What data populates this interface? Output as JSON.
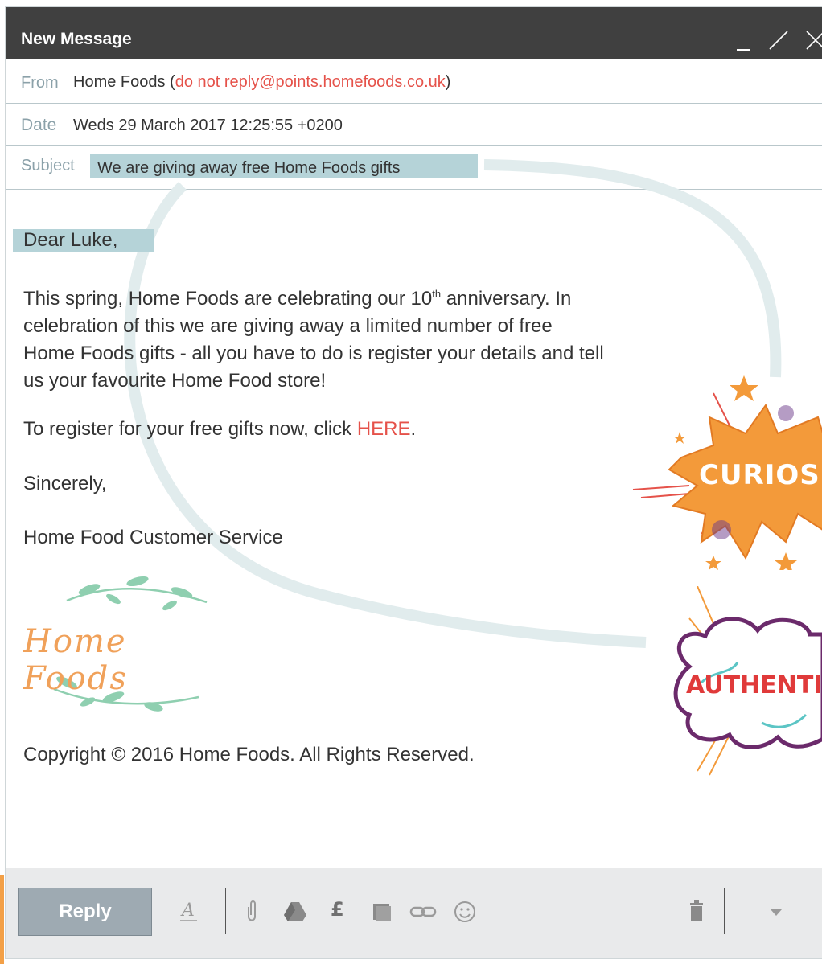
{
  "window": {
    "title": "New Message"
  },
  "header": {
    "from_label": "From",
    "from_name": "Home Foods (",
    "from_email": "do not reply@points.homefoods.co.uk",
    "from_close": ")",
    "date_label": "Date",
    "date_value": "Weds 29 March 2017 12:25:55 +0200",
    "subject_label": "Subject",
    "subject_value": "We are giving away free Home Foods gifts"
  },
  "body": {
    "greeting": "Dear Luke,",
    "para1_a": "This spring, Home Foods are celebrating our 10",
    "para1_sup": "th",
    "para1_b": " anniversary. In",
    "para1_line2": "celebration of this we are giving away a limited number of free",
    "para1_line3": "Home Foods gifts - all you have to do is register your details and tell",
    "para1_line4": "us your favourite Home Food store!",
    "register_text": "To register for your free gifts now, click ",
    "register_link": "HERE",
    "register_end": ".",
    "closing": "Sincerely,",
    "signature": "Home Food Customer Service",
    "logo_text": "Home Foods",
    "copyright": "Copyright © 2016 Home Foods. All Rights Reserved."
  },
  "stickers": {
    "curiosity": "CURIOSIT",
    "authenticity": "AUTHENTI"
  },
  "toolbar": {
    "reply_label": "Reply",
    "format_glyph": "A",
    "currency_glyph": "£"
  },
  "colors": {
    "titlebar": "#404040",
    "highlight": "#b5d3d8",
    "link": "#e5524a",
    "reply_button": "#9eaab2",
    "accent_orange": "#f3a047"
  },
  "icons": [
    "minimize-icon",
    "expand-icon",
    "close-icon",
    "attach-icon",
    "drive-icon",
    "currency-icon",
    "photo-icon",
    "link-icon",
    "emoji-icon",
    "trash-icon",
    "more-options-icon"
  ]
}
